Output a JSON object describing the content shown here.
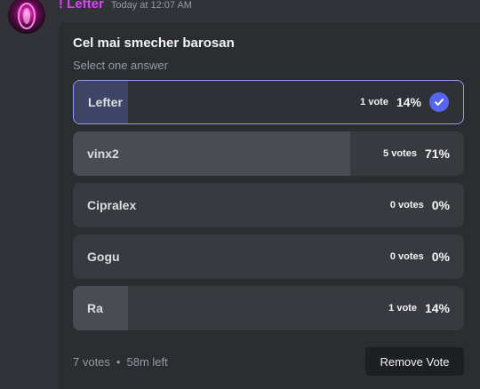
{
  "message": {
    "author": "! Lefter",
    "timestamp": "Today at 12:07 AM"
  },
  "poll": {
    "question": "Cel mai smecher barosan",
    "prompt": "Select one answer",
    "answers": [
      {
        "label": "Lefter",
        "votes": "1 vote",
        "percent": "14%",
        "fraction": 0.14,
        "selected": true
      },
      {
        "label": "vinx2",
        "votes": "5 votes",
        "percent": "71%",
        "fraction": 0.71,
        "selected": false
      },
      {
        "label": "Cipralex",
        "votes": "0 votes",
        "percent": "0%",
        "fraction": 0.0,
        "selected": false
      },
      {
        "label": "Gogu",
        "votes": "0 votes",
        "percent": "0%",
        "fraction": 0.0,
        "selected": false
      },
      {
        "label": "Ra",
        "votes": "1 vote",
        "percent": "14%",
        "fraction": 0.14,
        "selected": false
      }
    ],
    "total_votes": "7 votes",
    "separator": "•",
    "time_left": "58m left",
    "remove_vote_label": "Remove Vote"
  },
  "colors": {
    "username": "#e040fb",
    "accent": "#5865f2",
    "background": "#313338"
  },
  "icons": {
    "selected_answer": "checkmark-icon"
  }
}
